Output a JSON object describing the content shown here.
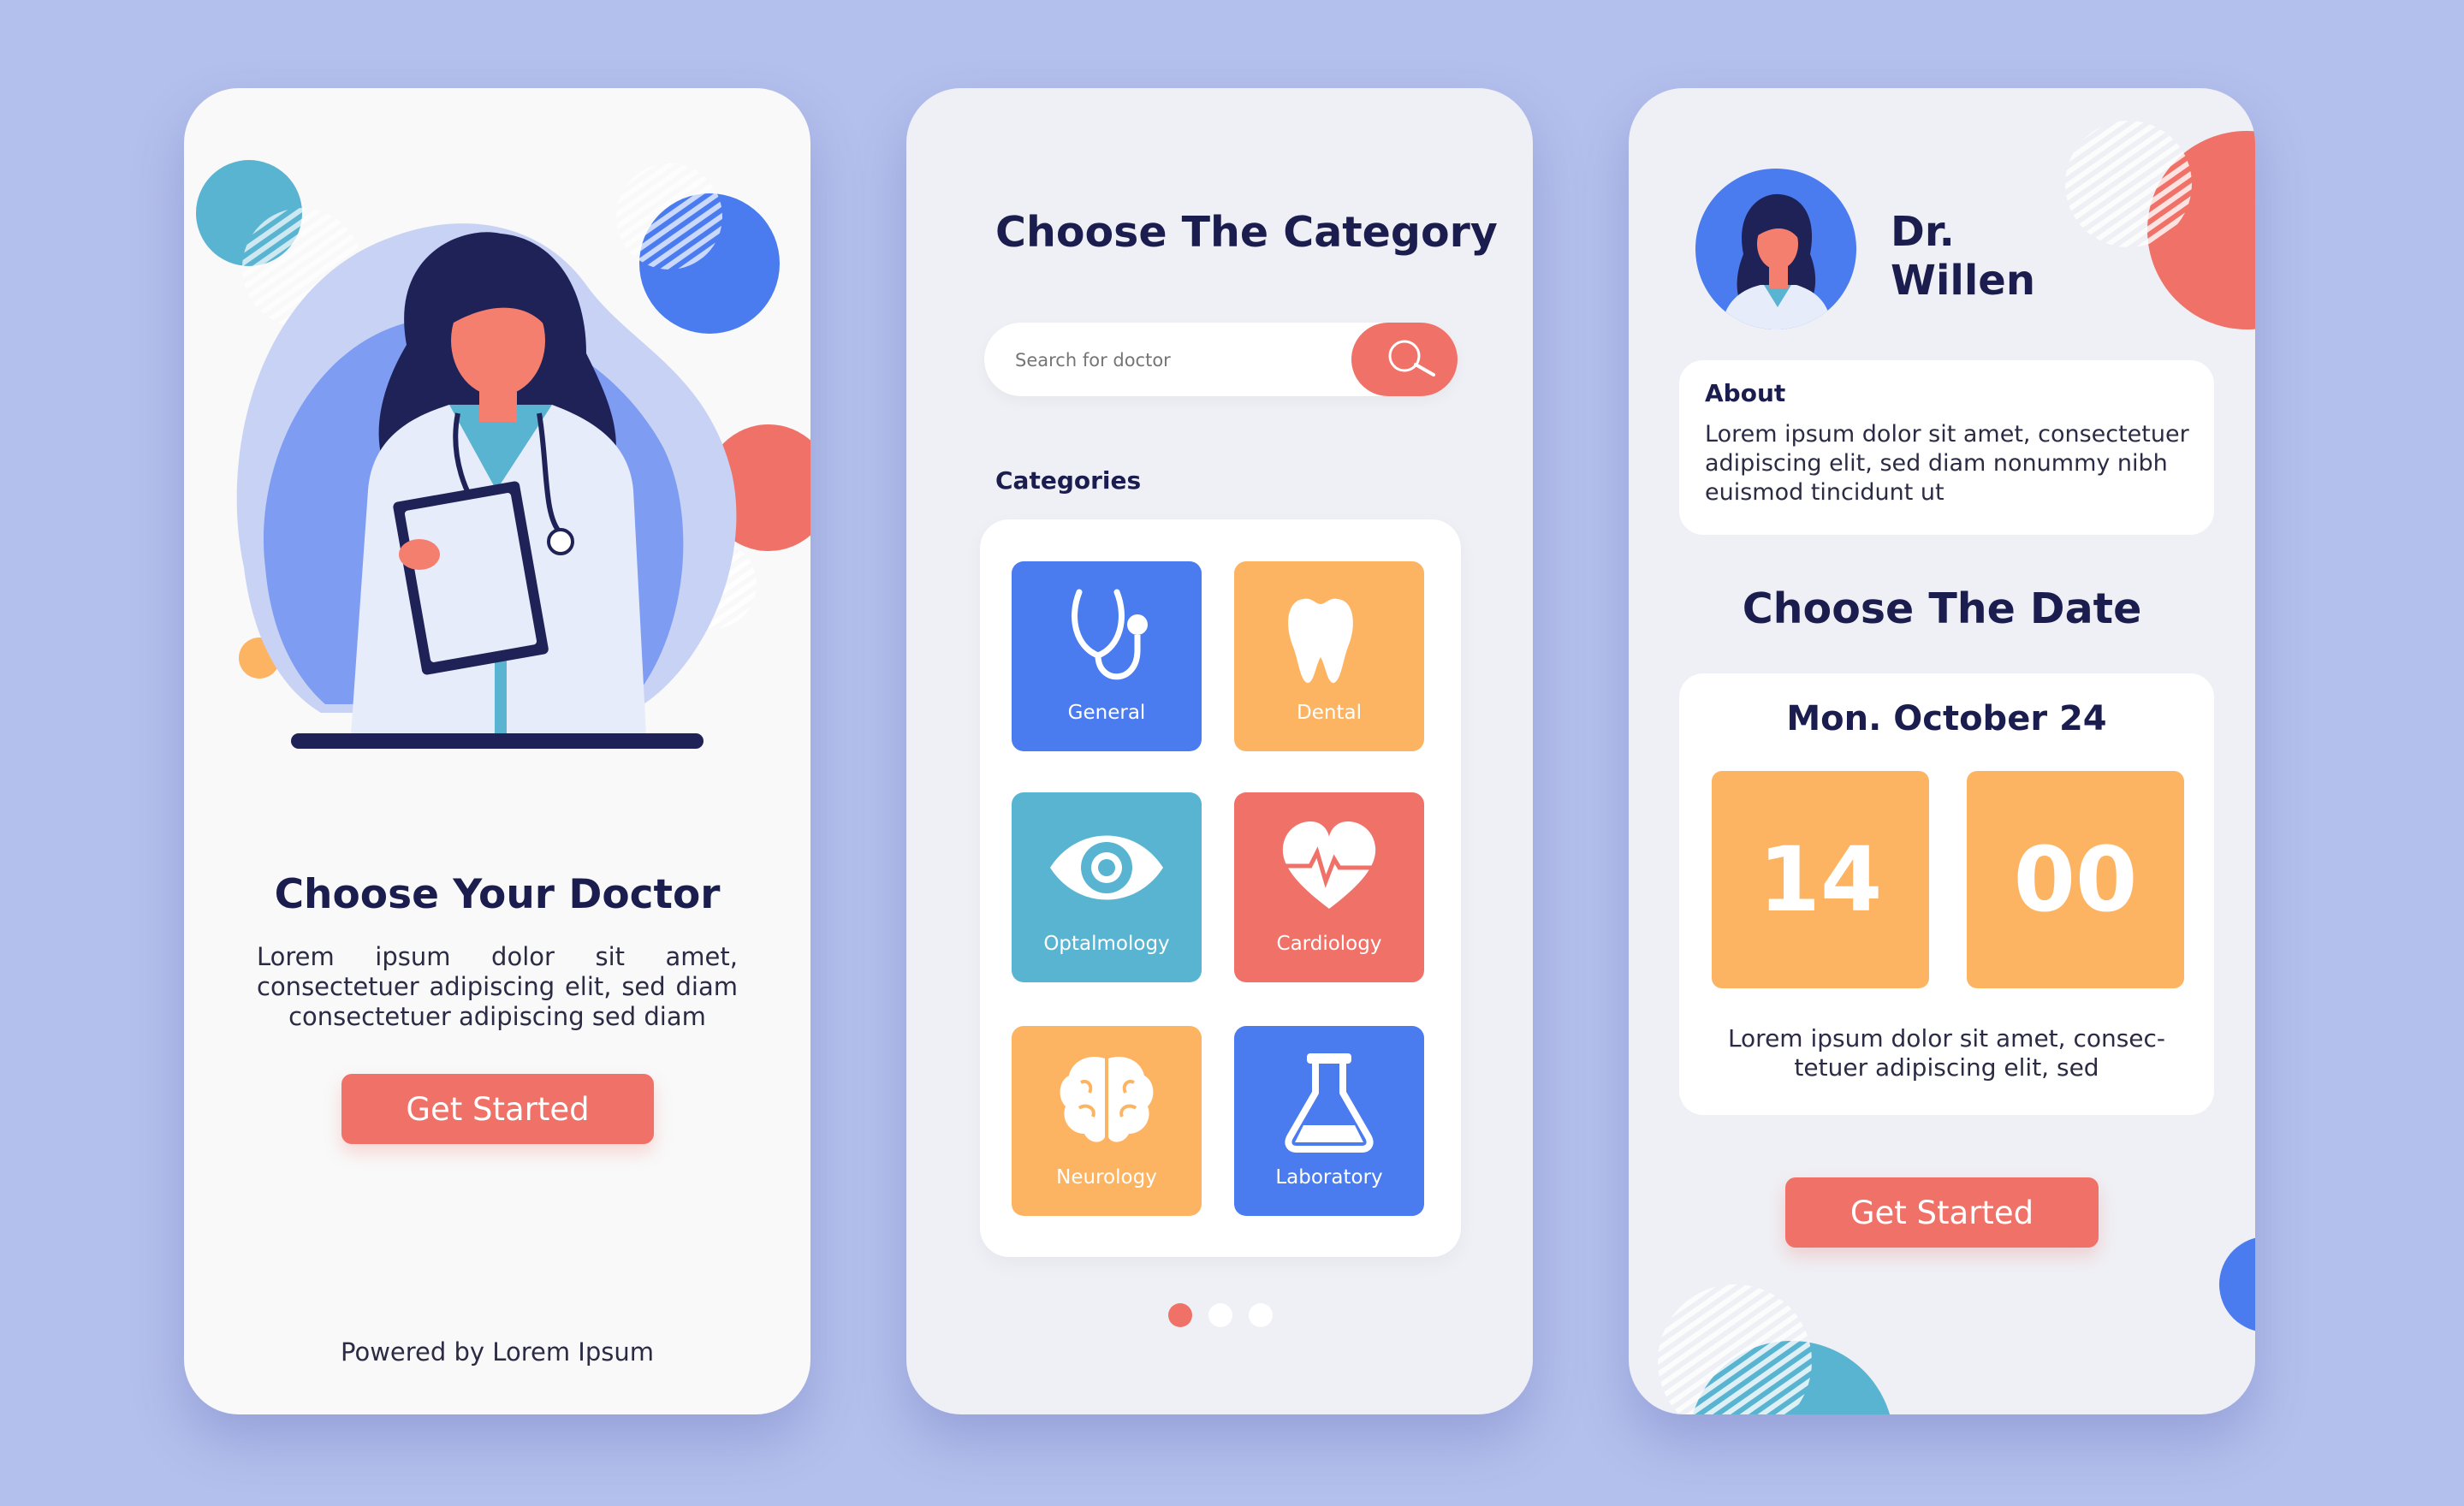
{
  "colors": {
    "background": "#b3bfec",
    "coral": "#f07167",
    "blue": "#4a7cf0",
    "orange": "#fdb462",
    "teal": "#58b4d1",
    "navy": "#1c1d4f"
  },
  "onboarding": {
    "title": "Choose Your Doctor",
    "description": "Lorem ipsum dolor sit amet, consectetuer adipiscing elit, sed diam consectetuer adipiscing sed diam",
    "button_label": "Get Started",
    "footer": "Powered by Lorem Ipsum"
  },
  "category_screen": {
    "title": "Choose The Category",
    "search_placeholder": "Search for doctor",
    "categories_label": "Categories",
    "categories": [
      {
        "label": "General",
        "icon": "stethoscope-icon",
        "color": "#4a7cf0"
      },
      {
        "label": "Dental",
        "icon": "tooth-icon",
        "color": "#fdb462"
      },
      {
        "label": "Optalmology",
        "icon": "eye-icon",
        "color": "#58b4d1"
      },
      {
        "label": "Cardiology",
        "icon": "heart-icon",
        "color": "#f07167"
      },
      {
        "label": "Neurology",
        "icon": "brain-icon",
        "color": "#fdb462"
      },
      {
        "label": "Laboratory",
        "icon": "flask-icon",
        "color": "#4a7cf0"
      }
    ],
    "pagination": {
      "total": 3,
      "active": 1
    }
  },
  "booking": {
    "doctor_name": "Dr. Willen",
    "about_title": "About",
    "about_text": "Lorem ipsum dolor sit amet, consectetuer adipiscing elit, sed diam nonummy nibh euismod tincidunt ut",
    "date_title": "Choose The Date",
    "date_label": "Mon. October 24",
    "hour": "14",
    "minute": "00",
    "note": "Lorem ipsum dolor sit amet, consec- tetuer adipiscing elit, sed",
    "button_label": "Get Started"
  }
}
